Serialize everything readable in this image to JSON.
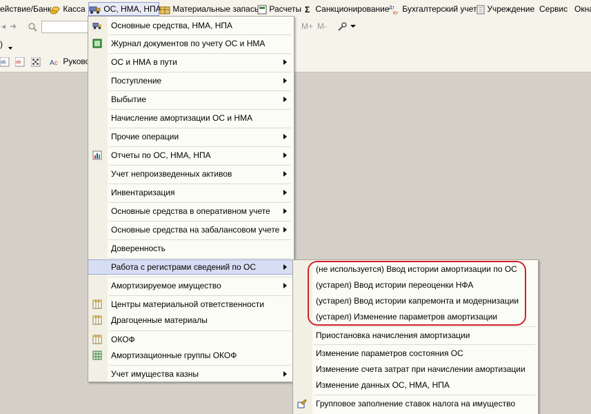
{
  "menubar": {
    "items": [
      {
        "label": "ействие/Банк",
        "icon": "bank-icon"
      },
      {
        "label": "Касса",
        "icon": "coins-icon"
      },
      {
        "label": "ОС, НМА, НПА",
        "icon": "truck-icon",
        "active": true
      },
      {
        "label": "Материальные запасы",
        "icon": "warehouse-icon"
      },
      {
        "label": "Расчеты",
        "icon": "calculator-icon"
      },
      {
        "label": "Санкционирование",
        "icon": "sigma-icon"
      },
      {
        "label": "Бухгалтерский учет",
        "icon": "dt-kt-icon"
      },
      {
        "label": "Учреждение",
        "icon": "document-icon"
      },
      {
        "label": "Сервис"
      },
      {
        "label": "Окна"
      }
    ]
  },
  "toolbar": {
    "m_plus": "M+",
    "m_minus": "M-",
    "paren": ")",
    "rukovod_label": "Руковод"
  },
  "main_menu": {
    "items": [
      {
        "label": "Основные средства, НМА, НПА",
        "icon": "truck-icon",
        "submenu": false
      },
      {
        "label": "Журнал документов по учету ОС и НМА",
        "icon": "journal-icon",
        "submenu": false
      },
      {
        "label": "ОС и НМА в пути",
        "submenu": true
      },
      {
        "label": "Поступление",
        "submenu": true
      },
      {
        "label": "Выбытие",
        "submenu": true
      },
      {
        "label": "Начисление амортизации ОС и НМА",
        "submenu": false
      },
      {
        "label": "Прочие операции",
        "submenu": true
      },
      {
        "label": "Отчеты по ОС, НМА, НПА",
        "icon": "report-icon",
        "submenu": true
      },
      {
        "label": "Учет непроизведенных активов",
        "submenu": true
      },
      {
        "label": "Инвентаризация",
        "submenu": true
      },
      {
        "label": "Основные средства в оперативном учете",
        "submenu": true
      },
      {
        "label": "Основные средства на забалансовом учете",
        "submenu": true
      },
      {
        "label": "Доверенность",
        "submenu": false
      },
      {
        "label": "Работа с регистрами сведений по ОС",
        "submenu": true,
        "highlighted": true
      },
      {
        "label": "Амортизируемое имущество",
        "submenu": true
      },
      {
        "label": "Центры материальной ответственности",
        "icon": "table-icon",
        "submenu": false
      },
      {
        "label": "Драгоценные материалы",
        "icon": "table-icon",
        "submenu": false
      },
      {
        "label": "ОКОФ",
        "icon": "table-icon",
        "submenu": false
      },
      {
        "label": "Амортизационные группы ОКОФ",
        "icon": "grid-icon",
        "submenu": false
      },
      {
        "label": "Учет имущества казны",
        "submenu": true
      }
    ]
  },
  "submenu": {
    "items": [
      {
        "label": "(не используется) Ввод истории амортизации по ОС"
      },
      {
        "label": "(устарел) Ввод истории переоценки НФА"
      },
      {
        "label": "(устарел) Ввод истории капремонта и модернизации"
      },
      {
        "label": "(устарел) Изменение параметров амортизации"
      },
      {
        "label": "Приостановка начисления амортизации"
      },
      {
        "label": "Изменение параметров состояния ОС"
      },
      {
        "label": "Изменение счета затрат при начислении амортизации"
      },
      {
        "label": "Изменение данных ОС, НМА, НПА"
      },
      {
        "label": "Групповое заполнение ставок налога на имущество",
        "icon": "group-fill-icon"
      }
    ]
  },
  "colors": {
    "highlight": "#d7ddf3",
    "annotation": "#d0202a",
    "background": "#d4d0c8"
  }
}
